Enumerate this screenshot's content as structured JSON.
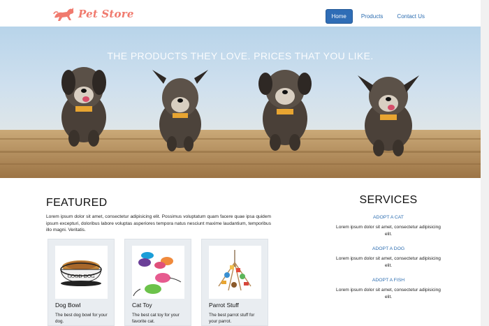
{
  "brand": {
    "name": "Pet Store",
    "logo_icon": "dog-icon"
  },
  "nav": {
    "items": [
      {
        "label": "Home",
        "active": true
      },
      {
        "label": "Products",
        "active": false
      },
      {
        "label": "Contact Us",
        "active": false
      }
    ]
  },
  "hero": {
    "tagline": "THE PRODUCTS THEY LOVE. PRICES THAT YOU LIKE."
  },
  "featured": {
    "heading": "FEATURED",
    "intro": "Lorem ipsum dolor sit amet, consectetur adipisicing elit. Possimus voluptatum quam facere quae ipsa quidem ipsum excepturi, doloribus labore voluptas asperiores tempora natus nesciunt maxime laudantium, temporibus illo magni. Veritatis.",
    "products": [
      {
        "title": "Dog Bowl",
        "desc": "The best dog bowl for your dog.",
        "bowl_label": "GOOD DOG"
      },
      {
        "title": "Cat Toy",
        "desc": "The best cat toy for your favorite cat."
      },
      {
        "title": "Parrot Stuff",
        "desc": "The best parrot stuff for your parrot."
      }
    ]
  },
  "services": {
    "heading": "SERVICES",
    "items": [
      {
        "link": "ADOPT A CAT",
        "text": "Lorem ipsum dolor sit amet, consectetur adipisicing elit."
      },
      {
        "link": "ADOPT A DOG",
        "text": "Lorem ipsum dolor sit amet, consectetur adipisicing elit."
      },
      {
        "link": "ADOPT A FISH",
        "text": "Lorem ipsum dolor sit amet, consectetur adipisicing elit."
      }
    ]
  },
  "colors": {
    "brand": "#f07a6e",
    "primary": "#2f6db6",
    "link": "#2b6cb0"
  }
}
